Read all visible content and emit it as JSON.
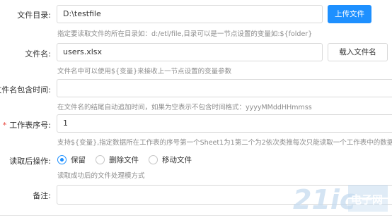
{
  "form": {
    "dir": {
      "label": "文件目录:",
      "value": "D:\\testfile",
      "hint": "指定要读取文件的所在目录如：d:/etl/file,目录可以是一节点设置的变量如:${folder}",
      "button": "上传文件"
    },
    "filename": {
      "label": "文件名:",
      "value": "users.xlsx",
      "hint": "文件名中可以使用${变量}来接收上一节点设置的变量参数",
      "button": "载入文件名"
    },
    "time_suffix": {
      "label": "文件名包含时间:",
      "value": "",
      "hint": "在文件名的结尾自动追加时间，如果为空表示不包含时间格式：yyyyMMddHHmmss"
    },
    "sheet_index": {
      "required_mark": "*",
      "label": "工作表序号:",
      "value": "1",
      "hint": "支持${变量},指定数据所在工作表的序号第一个Sheet1为1第二个为2依次类推每次只能读取一个工作表中的数据"
    },
    "after_read": {
      "label": "读取后操作:",
      "options": [
        "保留",
        "删除文件",
        "移动文件"
      ],
      "selected": "保留",
      "hint": "读取成功后的文件处理模方式"
    },
    "remark": {
      "label": "备注:",
      "value": ""
    }
  },
  "watermark": {
    "brand": "21ic",
    "text": "电子网"
  },
  "colors": {
    "primary": "#1e90ff",
    "required": "#e8453c",
    "hint": "#8c8c8c",
    "border": "#d9d9d9"
  }
}
